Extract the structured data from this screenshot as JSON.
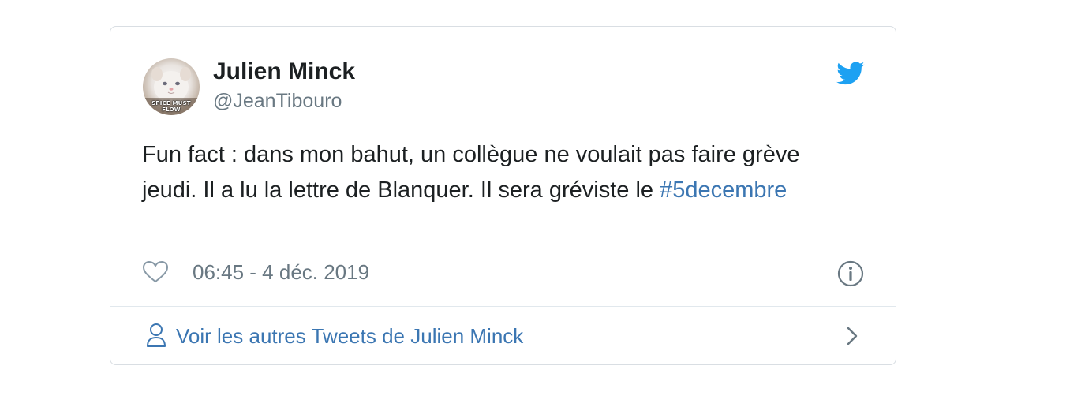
{
  "author": {
    "display_name": "Julien Minck",
    "handle": "@JeanTibouro",
    "avatar_caption": "SPICE MUST FLOW"
  },
  "tweet": {
    "text": "Fun fact : dans mon bahut, un collègue ne voulait pas faire grève jeudi. Il a lu la lettre de Blanquer. Il sera gréviste le ",
    "hashtag": "#5decembre",
    "timestamp": "06:45 - 4 déc. 2019"
  },
  "footer": {
    "more_tweets_label": "Voir les autres Tweets de Julien Minck"
  },
  "icons": {
    "brand": "twitter-bird-icon",
    "like": "heart-icon",
    "info": "info-icon",
    "profile": "person-icon",
    "chevron": "chevron-right-icon"
  },
  "colors": {
    "brand_blue": "#1da1f2",
    "link_blue": "#3b76b2",
    "secondary_text": "#697882",
    "border": "#d9dee3"
  }
}
